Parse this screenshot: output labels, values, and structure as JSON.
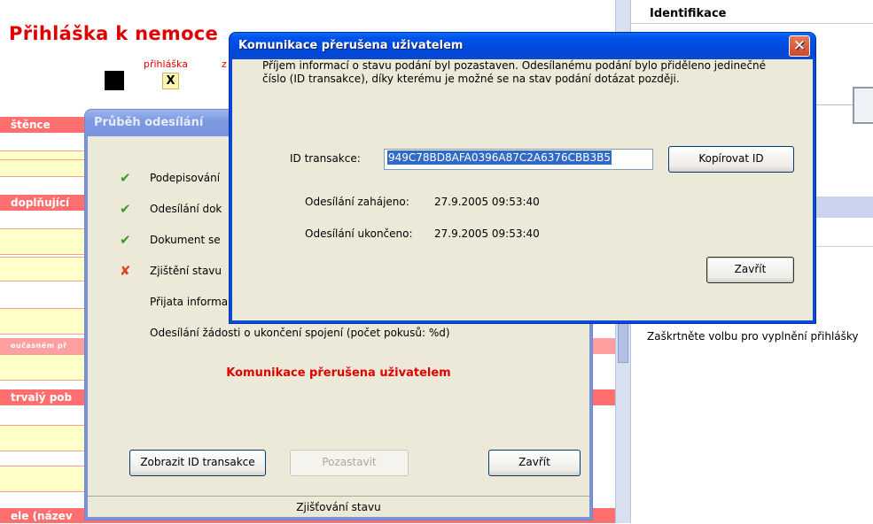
{
  "background": {
    "form_title": "Přihláška k nemoce",
    "sub1": "přihláška",
    "sub2": "z",
    "x_mark": "X",
    "sections": [
      "štěnce",
      "doplňující",
      "oučasném př",
      "trvalý pob",
      "ele (název"
    ],
    "right_title": "Identifikace",
    "right_hint": "Zaškrtněte volbu pro vyplnění přihlášky"
  },
  "progress_dialog": {
    "title": "Průběh odesílání",
    "steps": [
      {
        "icon": "check",
        "text": "Podepisování"
      },
      {
        "icon": "check",
        "text": "Odesílání dok"
      },
      {
        "icon": "check",
        "text": "Dokument se"
      },
      {
        "icon": "cross",
        "text": "Zjištění stavu"
      },
      {
        "icon": "none",
        "text": "Přijata informa"
      },
      {
        "icon": "none",
        "text": "Odesílání žádosti o ukončení spojení (počet pokusů: %d)"
      }
    ],
    "status_message": "Komunikace přerušena uživatelem",
    "buttons": {
      "show_id": "Zobrazit ID transakce",
      "pause": "Pozastavit",
      "close": "Zavřít"
    },
    "statusbar": "Zjišťování stavu"
  },
  "main_dialog": {
    "title": "Komunikace přerušena uživatelem",
    "message": "Příjem informací o stavu podání byl pozastaven. Odesílanému podání bylo přiděleno jedinečné číslo (ID transakce), díky kterému je možné se na stav podání dotázat později.",
    "id_label": "ID transakce:",
    "id_value": "949C78BD8AFA0396A87C2A6376CBB3B5",
    "copy_button": "Kopírovat ID",
    "started_label": "Odesílání zahájeno:",
    "started_value": "27.9.2005 09:53:40",
    "ended_label": "Odesílání ukončeno:",
    "ended_value": "27.9.2005 09:53:40",
    "close_button": "Zavřít"
  },
  "colors": {
    "title_bar": "#0052e8",
    "form_red": "#e00000",
    "section_red": "#ff6f6f",
    "field_yellow": "#ffffc8",
    "dialog_face": "#ece9d8"
  }
}
